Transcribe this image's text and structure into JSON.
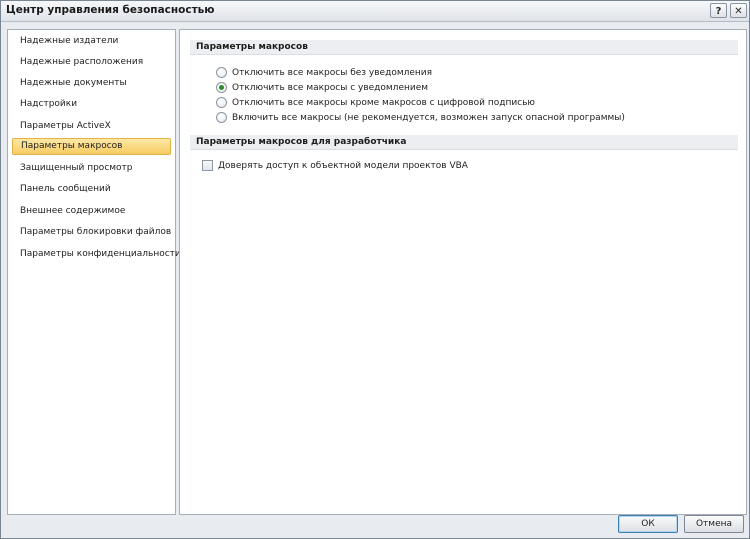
{
  "window": {
    "title": "Центр управления безопасностью",
    "help_glyph": "?",
    "close_glyph": "✕"
  },
  "sidebar": {
    "items": [
      {
        "label": "Надежные издатели",
        "active": false
      },
      {
        "label": "Надежные расположения",
        "active": false
      },
      {
        "label": "Надежные документы",
        "active": false
      },
      {
        "label": "Надстройки",
        "active": false
      },
      {
        "label": "Параметры ActiveX",
        "active": false
      },
      {
        "label": "Параметры макросов",
        "active": true
      },
      {
        "label": "Защищенный просмотр",
        "active": false
      },
      {
        "label": "Панель сообщений",
        "active": false
      },
      {
        "label": "Внешнее содержимое",
        "active": false
      },
      {
        "label": "Параметры блокировки файлов",
        "active": false
      },
      {
        "label": "Параметры конфиденциальности",
        "active": false
      }
    ]
  },
  "macro_settings": {
    "heading": "Параметры макросов",
    "options": [
      {
        "label": "Отключить все макросы без уведомления",
        "selected": false
      },
      {
        "label": "Отключить все макросы с уведомлением",
        "selected": true
      },
      {
        "label": "Отключить все макросы кроме макросов с цифровой подписью",
        "selected": false
      },
      {
        "label": "Включить все макросы (не рекомендуется, возможен запуск опасной программы)",
        "selected": false
      }
    ]
  },
  "developer_settings": {
    "heading": "Параметры макросов для разработчика",
    "vba_access": {
      "label": "Доверять доступ к объектной модели проектов VBA",
      "checked": false
    }
  },
  "buttons": {
    "ok": "ОК",
    "cancel": "Отмена"
  }
}
